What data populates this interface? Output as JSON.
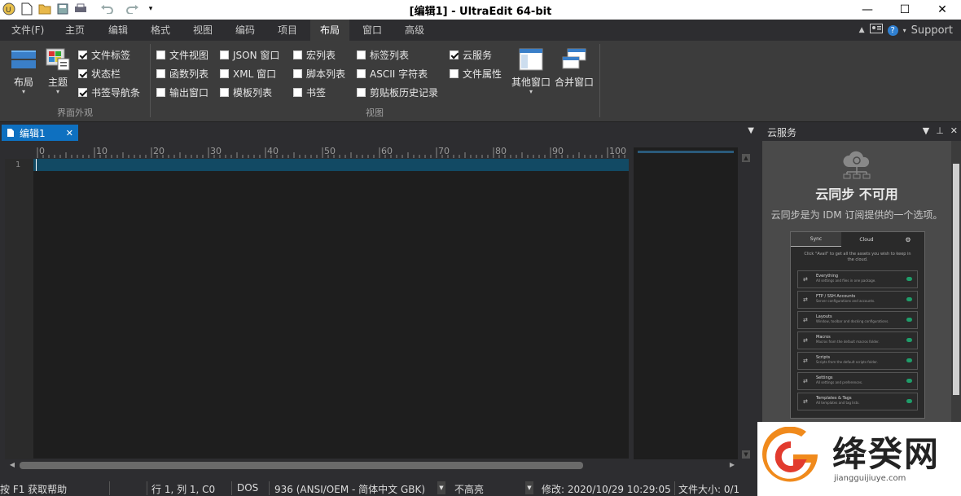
{
  "titlebar": {
    "title": "[编辑1] - UltraEdit 64-bit",
    "minimize": "—",
    "maximize": "☐",
    "close": "✕"
  },
  "menu": {
    "tabs": [
      "文件(F)",
      "主页",
      "编辑",
      "格式",
      "视图",
      "编码",
      "项目",
      "布局",
      "窗口",
      "高级"
    ],
    "active": "布局",
    "support": "Support",
    "up_arrow": "▲",
    "help_glyph": "?"
  },
  "ribbon": {
    "appearance": {
      "layout_label": "布局",
      "theme_label": "主题",
      "checks": [
        {
          "label": "文件标签",
          "checked": true
        },
        {
          "label": "状态栏",
          "checked": true
        },
        {
          "label": "书签导航条",
          "checked": true
        }
      ],
      "group_label": "界面外观"
    },
    "view": {
      "checks": [
        {
          "label": "文件视图",
          "checked": false
        },
        {
          "label": "函数列表",
          "checked": false
        },
        {
          "label": "输出窗口",
          "checked": false
        },
        {
          "label": "JSON 窗口",
          "checked": false
        },
        {
          "label": "XML 窗口",
          "checked": false
        },
        {
          "label": "模板列表",
          "checked": false
        },
        {
          "label": "宏列表",
          "checked": false
        },
        {
          "label": "脚本列表",
          "checked": false
        },
        {
          "label": "书签",
          "checked": false
        },
        {
          "label": "标签列表",
          "checked": false
        },
        {
          "label": "ASCII 字符表",
          "checked": false
        },
        {
          "label": "剪贴板历史记录",
          "checked": false
        },
        {
          "label": "云服务",
          "checked": true
        },
        {
          "label": "文件属性",
          "checked": false
        }
      ],
      "other_windows_label": "其他窗口",
      "merge_windows_label": "合并窗口",
      "group_label": "视图"
    }
  },
  "document": {
    "tab_label": "编辑1",
    "tab_close": "✕",
    "line_number": "1",
    "ruler_numbers": [
      "0",
      "10",
      "20",
      "30",
      "40",
      "50",
      "60",
      "70",
      "80",
      "90",
      "100"
    ]
  },
  "cloud_panel": {
    "header": "云服务",
    "title": "云同步 不可用",
    "subtitle": "云同步是为 IDM 订阅提供的一个选项。",
    "preview": {
      "tabs": [
        "Sync",
        "Cloud"
      ],
      "intro": "Click \"Avail\" to get all the assets you wish to keep in the cloud.",
      "rows": [
        {
          "name": "Everything",
          "desc": "All settings and files in one package."
        },
        {
          "name": "FTP / SSH Accounts",
          "desc": "Server configurations and accounts."
        },
        {
          "name": "Layouts",
          "desc": "Window, toolbar and docking configurations."
        },
        {
          "name": "Macros",
          "desc": "Macros from the default macros folder."
        },
        {
          "name": "Scripts",
          "desc": "Scripts from the default scripts folder."
        },
        {
          "name": "Settings",
          "desc": "All settings and preferences."
        },
        {
          "name": "Templates & Tags",
          "desc": "All templates and tag lists."
        }
      ]
    }
  },
  "statusbar": {
    "help": "按 F1 获取帮助",
    "position": "行 1, 列 1, C0",
    "line_ending": "DOS",
    "encoding": "936   (ANSI/OEM - 简体中文 GBK)",
    "highlight": "不高亮",
    "modified": "修改:   2020/10/29 10:29:05",
    "filesize": "文件大小:   0/1"
  },
  "watermark": {
    "name": "绛癸网",
    "url": "jiangguijiuye.com"
  },
  "colors": {
    "accent": "#0e70c0",
    "current_line": "#124a64",
    "editor_bg": "#1e1e1e",
    "ribbon_bg": "#3c3c3c"
  }
}
